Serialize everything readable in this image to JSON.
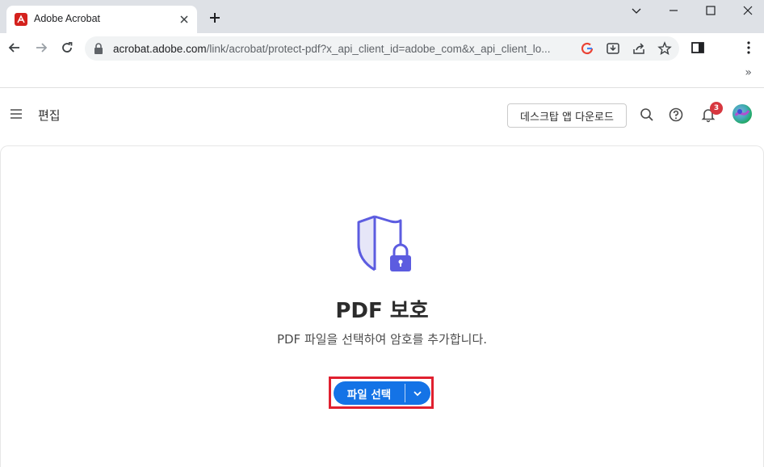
{
  "browser": {
    "tab_title": "Adobe Acrobat",
    "url_host": "acrobat.adobe.com",
    "url_path": "/link/acrobat/protect-pdf?x_api_client_id=adobe_com&x_api_client_lo..."
  },
  "header": {
    "edit_label": "편집",
    "download_button": "데스크탑 앱 다운로드",
    "notification_count": "3"
  },
  "main": {
    "title": "PDF 보호",
    "description": "PDF 파일을 선택하여 암호를 추가합니다.",
    "select_button": "파일 선택"
  },
  "colors": {
    "accent": "#1473e6",
    "shield": "#5c5ce0",
    "highlight": "#e0202f",
    "badge": "#d7373f"
  },
  "icons": [
    "acrobat-icon",
    "close-icon",
    "plus-icon",
    "back-icon",
    "forward-icon",
    "reload-icon",
    "lock-icon",
    "google-icon",
    "install-icon",
    "share-icon",
    "star-icon",
    "sidepanel-icon",
    "more-icon",
    "menu-icon",
    "search-icon",
    "help-icon",
    "bell-icon",
    "shield-lock-icon",
    "chevron-down-icon"
  ]
}
